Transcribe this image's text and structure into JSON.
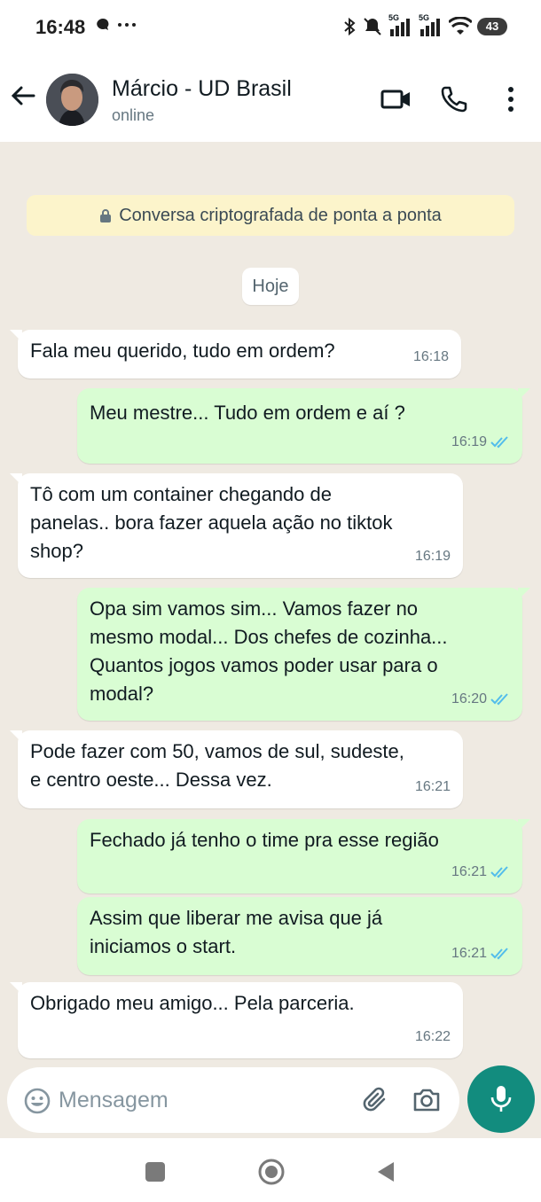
{
  "status_bar": {
    "time": "16:48",
    "battery": "43",
    "network_1": "5G",
    "network_2": "5G"
  },
  "header": {
    "name": "Márcio - UD Brasil",
    "status": "online"
  },
  "chat": {
    "encryption_notice": "Conversa criptografada de ponta a ponta",
    "date_label": "Hoje",
    "messages": [
      {
        "text": "Fala meu querido, tudo em ordem?",
        "time": "16:18",
        "direction": "in"
      },
      {
        "text": "Meu mestre... Tudo em ordem e aí ?",
        "time": "16:19",
        "direction": "out"
      },
      {
        "text": "Tô com um container chegando de\npanelas.. bora fazer aquela ação no tiktok\nshop?",
        "time": "16:19",
        "direction": "in"
      },
      {
        "text": "Opa sim vamos sim... Vamos fazer no\nmesmo modal... Dos chefes de cozinha...\nQuantos jogos vamos poder usar para o\nmodal?",
        "time": "16:20",
        "direction": "out"
      },
      {
        "text": "Pode fazer com 50, vamos de sul, sudeste,\ne centro oeste... Dessa vez.",
        "time": "16:21",
        "direction": "in"
      },
      {
        "text": "Fechado já tenho o time pra esse região",
        "time": "16:21",
        "direction": "out"
      },
      {
        "text": "Assim que liberar me avisa que já\niniciamos o start.",
        "time": "16:21",
        "direction": "out"
      },
      {
        "text": "Obrigado meu amigo... Pela parceria.",
        "time": "16:22",
        "direction": "in"
      }
    ]
  },
  "input": {
    "placeholder": "Mensagem"
  },
  "colors": {
    "accent": "#128c7e",
    "incoming_bubble": "#ffffff",
    "outgoing_bubble": "#d9fdd3",
    "read_ticks": "#53bdeb",
    "banner": "#fcf4cb"
  },
  "icons": {
    "header": [
      "back-arrow-icon",
      "video-call-icon",
      "phone-icon",
      "more-vert-icon"
    ],
    "input": [
      "emoji-icon",
      "attach-icon",
      "camera-icon",
      "mic-icon"
    ],
    "nav": [
      "recents-icon",
      "home-icon",
      "back-triangle-icon"
    ]
  }
}
